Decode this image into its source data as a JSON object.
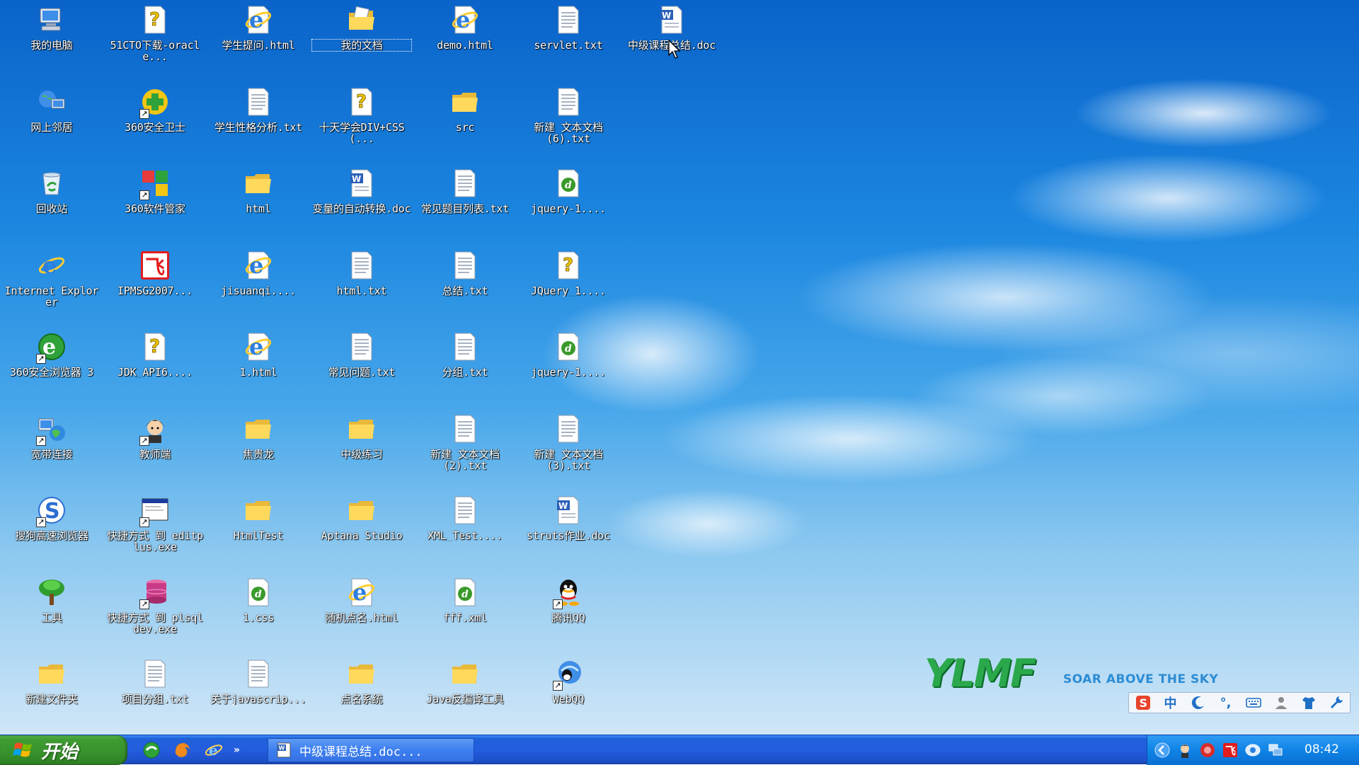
{
  "desktop": {
    "icons": [
      {
        "label": "我的电脑",
        "icon": "computer-icon",
        "shortcut": false
      },
      {
        "label": "网上邻居",
        "icon": "network-icon",
        "shortcut": false
      },
      {
        "label": "回收站",
        "icon": "recycle-bin-icon",
        "shortcut": false
      },
      {
        "label": "Internet Explorer",
        "icon": "ie-icon",
        "shortcut": false
      },
      {
        "label": "360安全浏览器 3",
        "icon": "360-browser-icon",
        "shortcut": true
      },
      {
        "label": "宽带连接",
        "icon": "broadband-icon",
        "shortcut": true
      },
      {
        "label": "搜狗高速浏览器",
        "icon": "sogou-browser-icon",
        "shortcut": true
      },
      {
        "label": "工具",
        "icon": "tree-icon",
        "shortcut": false
      },
      {
        "label": "新建文件夹",
        "icon": "folder-icon",
        "shortcut": false
      },
      {
        "label": "51CTO下载-oracle...",
        "icon": "unknown-file-icon",
        "shortcut": false
      },
      {
        "label": "360安全卫士",
        "icon": "360-safe-icon",
        "shortcut": true
      },
      {
        "label": "360软件管家",
        "icon": "360-software-icon",
        "shortcut": true
      },
      {
        "label": "IPMSG2007...",
        "icon": "ipmsg-icon",
        "shortcut": false
      },
      {
        "label": "JDK_API6....",
        "icon": "unknown-file-icon",
        "shortcut": false
      },
      {
        "label": "教师端",
        "icon": "teacher-icon",
        "shortcut": true
      },
      {
        "label": "快捷方式 到 editplus.exe",
        "icon": "window-icon",
        "shortcut": true
      },
      {
        "label": "快捷方式 到 plsqldev.exe",
        "icon": "database-icon",
        "shortcut": true
      },
      {
        "label": "项目分组.txt",
        "icon": "text-file-icon",
        "shortcut": false
      },
      {
        "label": "学生提问.html",
        "icon": "html-file-icon",
        "shortcut": false
      },
      {
        "label": "学生性格分析.txt",
        "icon": "text-file-icon",
        "shortcut": false
      },
      {
        "label": "html",
        "icon": "folder-icon",
        "shortcut": false
      },
      {
        "label": "jisuanqi....",
        "icon": "html-file-icon",
        "shortcut": false
      },
      {
        "label": "1.html",
        "icon": "html-file-icon",
        "shortcut": false
      },
      {
        "label": "焦贵龙",
        "icon": "folder-icon",
        "shortcut": false
      },
      {
        "label": "HtmlTest",
        "icon": "folder-icon",
        "shortcut": false
      },
      {
        "label": "1.css",
        "icon": "dreamweaver-file-icon",
        "shortcut": false
      },
      {
        "label": "关于javascrip...",
        "icon": "text-file-icon",
        "shortcut": false
      },
      {
        "label": "我的文档",
        "icon": "my-documents-icon",
        "shortcut": false,
        "selected": true
      },
      {
        "label": "十天学会DIV+CSS(...",
        "icon": "unknown-file-icon",
        "shortcut": false
      },
      {
        "label": "变量的自动转换.doc",
        "icon": "word-file-icon",
        "shortcut": false
      },
      {
        "label": "html.txt",
        "icon": "text-file-icon",
        "shortcut": false
      },
      {
        "label": "常见问题.txt",
        "icon": "text-file-icon",
        "shortcut": false
      },
      {
        "label": "中级练习",
        "icon": "folder-icon",
        "shortcut": false
      },
      {
        "label": "Aptana Studio",
        "icon": "folder-icon",
        "shortcut": false
      },
      {
        "label": "随机点名.html",
        "icon": "html-file-icon",
        "shortcut": false
      },
      {
        "label": "点名系统",
        "icon": "folder-icon",
        "shortcut": false
      },
      {
        "label": "demo.html",
        "icon": "html-file-icon",
        "shortcut": false
      },
      {
        "label": "src",
        "icon": "folder-icon",
        "shortcut": false
      },
      {
        "label": "常见题目列表.txt",
        "icon": "text-file-icon",
        "shortcut": false
      },
      {
        "label": "总结.txt",
        "icon": "text-file-icon",
        "shortcut": false
      },
      {
        "label": "分组.txt",
        "icon": "text-file-icon",
        "shortcut": false
      },
      {
        "label": "新建 文本文档 (2).txt",
        "icon": "text-file-icon",
        "shortcut": false
      },
      {
        "label": "XML_Test....",
        "icon": "text-file-icon",
        "shortcut": false
      },
      {
        "label": "fff.xml",
        "icon": "dreamweaver-file-icon",
        "shortcut": false
      },
      {
        "label": "Java反编译工具",
        "icon": "folder-icon",
        "shortcut": false
      },
      {
        "label": "servlet.txt",
        "icon": "text-file-icon",
        "shortcut": false
      },
      {
        "label": "新建 文本文档 (6).txt",
        "icon": "text-file-icon",
        "shortcut": false
      },
      {
        "label": "jquery-1....",
        "icon": "dreamweaver-file-icon",
        "shortcut": false
      },
      {
        "label": "JQuery_1....",
        "icon": "unknown-file-icon",
        "shortcut": false
      },
      {
        "label": "jquery-1....",
        "icon": "dreamweaver-file-icon",
        "shortcut": false
      },
      {
        "label": "新建 文本文档 (3).txt",
        "icon": "text-file-icon",
        "shortcut": false
      },
      {
        "label": "struts作业.doc",
        "icon": "word-file-icon",
        "shortcut": false
      },
      {
        "label": "腾讯QQ",
        "icon": "qq-icon",
        "shortcut": true
      },
      {
        "label": "WebQQ",
        "icon": "webqq-icon",
        "shortcut": true
      },
      {
        "label": "中级课程总结.doc",
        "icon": "word-file-icon",
        "shortcut": false
      }
    ]
  },
  "brand": {
    "logo": "YLMF",
    "slogan": "SOAR ABOVE THE SKY"
  },
  "ime_bar": {
    "items": [
      {
        "icon": "sogou-s-icon",
        "text": "S"
      },
      {
        "icon": "chinese-mode-icon",
        "text": "中"
      },
      {
        "icon": "half-width-moon-icon",
        "text": ""
      },
      {
        "icon": "punctuation-icon",
        "text": "°,"
      },
      {
        "icon": "keyboard-icon",
        "text": ""
      },
      {
        "icon": "user-icon",
        "text": ""
      },
      {
        "icon": "skin-shirt-icon",
        "text": ""
      },
      {
        "icon": "wrench-icon",
        "text": ""
      }
    ]
  },
  "taskbar": {
    "start_label": "开始",
    "quick_launch": [
      "360-browser-icon",
      "firefox-icon",
      "ie-icon"
    ],
    "more": "»",
    "active_task": "中级课程总结.doc...",
    "tray_icons": [
      "chevron-left-icon",
      "teacher-tray-icon",
      "red-circle-icon",
      "ipmsg-tray-icon",
      "network-tray-icon",
      "monitor-tray-icon"
    ],
    "clock": "08:42"
  },
  "colors": {
    "taskbar_blue": "#245de0",
    "start_green": "#3e9c32",
    "tray_blue": "#1083e6"
  }
}
